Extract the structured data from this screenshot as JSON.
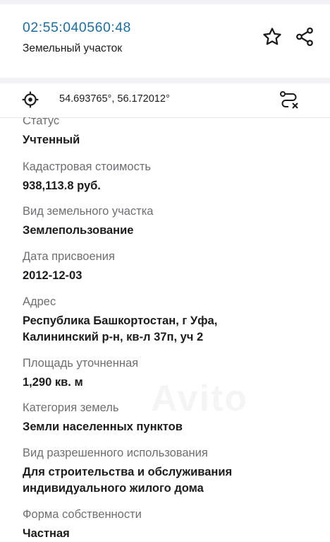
{
  "header": {
    "cadastral_number": "02:55:040560:48",
    "subtitle": "Земельный участок"
  },
  "icons": {
    "star": "star-outline-icon",
    "share": "share-icon",
    "locate": "crosshair-icon",
    "route": "route-clear-icon"
  },
  "location": {
    "coordinates": "54.693765°, 56.172012°"
  },
  "fields": [
    {
      "label": "Статус",
      "value": "Учтенный"
    },
    {
      "label": "Кадастровая стоимость",
      "value": "938,113.8 руб."
    },
    {
      "label": "Вид земельного участка",
      "value": "Землепользование"
    },
    {
      "label": "Дата присвоения",
      "value": "2012-12-03"
    },
    {
      "label": "Адрес",
      "value_lines": [
        "Республика Башкортостан, г Уфа,",
        "Калининский р-н, кв-л 37п, уч 2"
      ]
    },
    {
      "label": "Площадь уточненная",
      "value": "1,290 кв. м"
    },
    {
      "label": "Категория земель",
      "value": "Земли населенных пунктов"
    },
    {
      "label": "Вид разрешенного использования",
      "value_lines": [
        "Для строительства и обслуживания",
        "индивидуального жилого дома"
      ]
    },
    {
      "label": "Форма собственности",
      "value": "Частная"
    }
  ],
  "watermark": "Avito",
  "colors": {
    "accent": "#1b6fa3",
    "label": "#6f6f73",
    "text": "#1c1c1e",
    "separator": "#f2f2f4"
  }
}
